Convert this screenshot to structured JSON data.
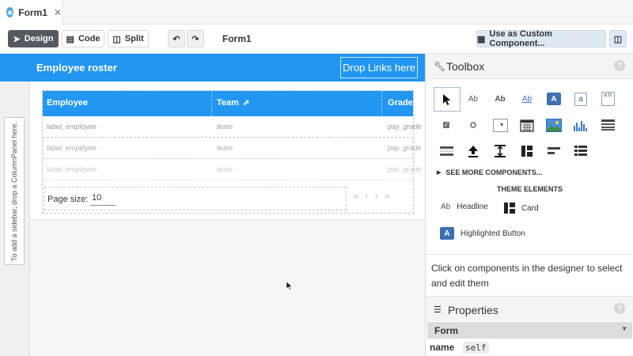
{
  "tab": {
    "label": "Form1",
    "close": "✕"
  },
  "toolbar": {
    "design_label": "Design",
    "code_label": "Code",
    "split_label": "Split",
    "form_title": "Form1",
    "custom_component_label": "Use as Custom Component..."
  },
  "designer": {
    "app_title": "Employee roster",
    "drop_links": "Drop Links here",
    "sidebar_hint": "To add a sidebar, drop a ColumnPanel here."
  },
  "grid": {
    "columns": [
      "Employee",
      "Team",
      "Grade"
    ],
    "rows": [
      [
        "label_employee",
        "team",
        "pay_grade"
      ],
      [
        "label_employee",
        "team",
        "pay_grade"
      ],
      [
        "label_employee",
        "team",
        "pay_grade"
      ]
    ],
    "page_size_label": "Page size:",
    "page_size_value": "10"
  },
  "toolbox": {
    "title": "Toolbox",
    "see_more": "SEE MORE COMPONENTS...",
    "theme_title": "THEME ELEMENTS",
    "theme_items": [
      "Headline",
      "Card",
      "Highlighted Button"
    ],
    "icons": [
      "pointer-icon",
      "label-icon",
      "bold-label-icon",
      "link-icon",
      "button-icon",
      "textbox-icon",
      "textarea-icon",
      "checkbox-icon",
      "radio-icon",
      "dropdown-icon",
      "datepicker-icon",
      "image-icon",
      "plot-icon",
      "datagrid-icon",
      "spacer-icon",
      "fileloader-icon",
      "timer-icon",
      "columnpanel-icon",
      "flowpanel-icon",
      "repeating-panel-icon"
    ],
    "accent": "#2196f3"
  },
  "hint": "Click on components in the designer to select and edit them",
  "properties": {
    "title": "Properties",
    "component": "Form",
    "name_label": "name",
    "name_value": "self"
  }
}
